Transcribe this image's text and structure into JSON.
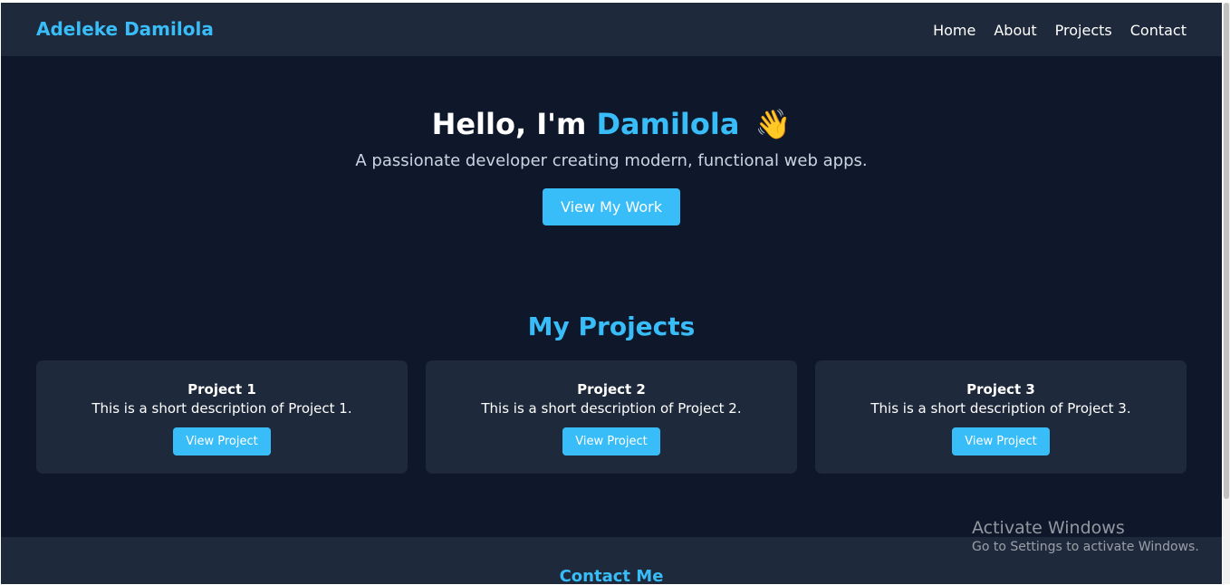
{
  "nav": {
    "brand": "Adeleke Damilola",
    "links": [
      "Home",
      "About",
      "Projects",
      "Contact"
    ]
  },
  "hero": {
    "greeting": "Hello, I'm",
    "name": "Damilola",
    "emoji": "👋",
    "subtitle": "A passionate developer creating modern, functional web apps.",
    "cta_label": "View My Work"
  },
  "projects": {
    "title": "My Projects",
    "items": [
      {
        "title": "Project 1",
        "description": "This is a short description of Project 1.",
        "button": "View Project"
      },
      {
        "title": "Project 2",
        "description": "This is a short description of Project 2.",
        "button": "View Project"
      },
      {
        "title": "Project 3",
        "description": "This is a short description of Project 3.",
        "button": "View Project"
      }
    ]
  },
  "contact": {
    "title": "Contact Me"
  },
  "watermark": {
    "title": "Activate Windows",
    "subtitle": "Go to Settings to activate Windows."
  },
  "colors": {
    "accent": "#38bdf8",
    "background": "#0f172a",
    "surface": "#1e293b"
  }
}
